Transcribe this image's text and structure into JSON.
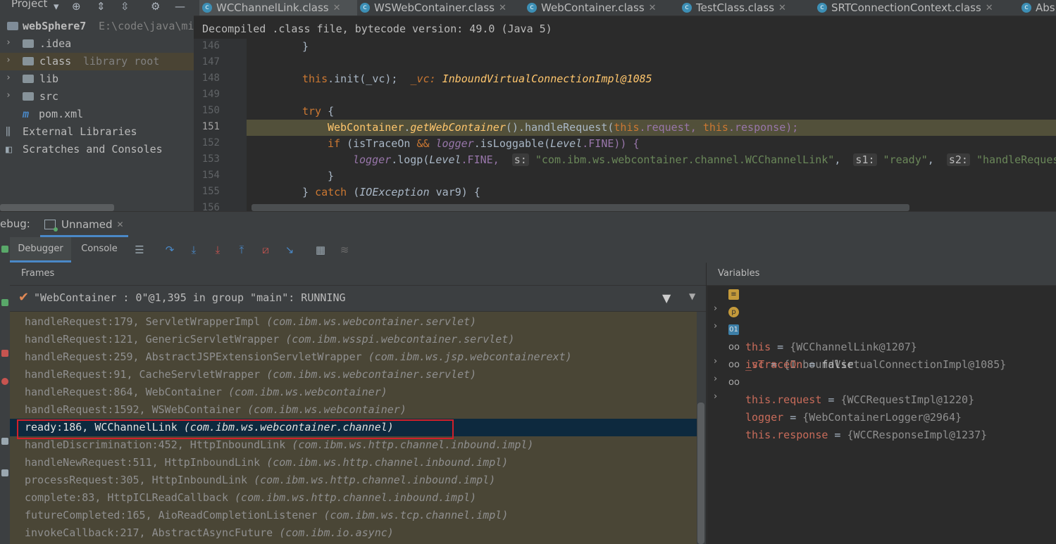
{
  "project_panel": {
    "title": "Project",
    "header_icons": [
      "dropdown-icon",
      "locate-icon",
      "expand-all-icon",
      "collapse-all-icon",
      "gear-icon",
      "hide-icon"
    ],
    "tree": [
      {
        "label": "webSphere7",
        "extra": "E:\\code\\java\\mi",
        "icon": "module-folder-icon",
        "bold": true
      },
      {
        "label": ".idea",
        "icon": "folder-icon"
      },
      {
        "label": "class",
        "extra": "library root",
        "icon": "folder-icon"
      },
      {
        "label": "lib",
        "icon": "folder-icon"
      },
      {
        "label": "src",
        "icon": "folder-icon"
      },
      {
        "label": "pom.xml",
        "icon": "maven-icon"
      },
      {
        "label": "External Libraries",
        "icon": "libraries-icon"
      },
      {
        "label": "Scratches and Consoles",
        "icon": "scratches-icon"
      }
    ]
  },
  "tabs": [
    {
      "label": "WCChannelLink.class",
      "active": true
    },
    {
      "label": "WSWebContainer.class"
    },
    {
      "label": "WebContainer.class"
    },
    {
      "label": "TestClass.class"
    },
    {
      "label": "SRTConnectionContext.class"
    },
    {
      "label": "Abs"
    }
  ],
  "editor": {
    "banner": "Decompiled .class file, bytecode version: 49.0 (Java 5)",
    "line_numbers": [
      "146",
      "147",
      "148",
      "149",
      "150",
      "151",
      "152",
      "153",
      "154",
      "155",
      "156"
    ],
    "current_line": "151",
    "code": {
      "l146": "}",
      "l148_a": "this",
      "l148_b": ".init(_vc);",
      "l148_hint_name": "_vc:",
      "l148_hint_val": "InboundVirtualConnectionImpl@1085",
      "l150_kw": "try",
      "l150_rest": " {",
      "l151_a": "WebContainer",
      "l151_b": ".",
      "l151_c": "getWebContainer",
      "l151_d": "().handleRequest(",
      "l151_e": "this",
      "l151_f": ".request, ",
      "l151_g": "this",
      "l151_h": ".response);",
      "l152_kw": "if",
      "l152_a": " (isTraceOn ",
      "l152_b": "&&",
      "l152_c": " ",
      "l152_d": "logger",
      "l152_e": ".isLoggable(",
      "l152_f": "Level",
      "l152_g": ".FINE)) {",
      "l153_a": "logger",
      "l153_b": ".logp(",
      "l153_c": "Level",
      "l153_d": ".FINE, ",
      "l153_s": "s:",
      "l153_sv": "\"com.ibm.ws.webcontainer.channel.WCChannelLink\"",
      "l153_comma1": ",",
      "l153_s1": "s1:",
      "l153_s1v": "\"ready\"",
      "l153_comma2": ",",
      "l153_s2": "s2:",
      "l153_s2v": "\"handleRequest co",
      "l154": "}",
      "l155_a": "} ",
      "l155_kw": "catch",
      "l155_b": " (",
      "l155_c": "IOException",
      "l155_d": " var9) {"
    }
  },
  "debug": {
    "label": "ebug:",
    "session": "Unnamed",
    "tabs": [
      "Debugger",
      "Console"
    ],
    "toolbar_icons": [
      "layout-icon",
      "step-over-icon",
      "step-into-icon",
      "force-step-into-icon",
      "step-out-icon",
      "drop-frame-icon",
      "run-to-cursor-icon",
      "evaluate-icon",
      "trace-icon"
    ],
    "frames_title": "Frames",
    "thread": "\"WebContainer : 0\"@1,395 in group \"main\": RUNNING",
    "frames": [
      {
        "method": "handleRequest:179, ServletWrapperImpl ",
        "pkg": "(com.ibm.ws.webcontainer.servlet)"
      },
      {
        "method": "handleRequest:121, GenericServletWrapper ",
        "pkg": "(com.ibm.wsspi.webcontainer.servlet)"
      },
      {
        "method": "handleRequest:259, AbstractJSPExtensionServletWrapper ",
        "pkg": "(com.ibm.ws.jsp.webcontainerext)"
      },
      {
        "method": "handleRequest:91, CacheServletWrapper ",
        "pkg": "(com.ibm.ws.webcontainer.servlet)"
      },
      {
        "method": "handleRequest:864, WebContainer ",
        "pkg": "(com.ibm.ws.webcontainer)"
      },
      {
        "method": "handleRequest:1592, WSWebContainer ",
        "pkg": "(com.ibm.ws.webcontainer)"
      },
      {
        "method": "ready:186, WCChannelLink ",
        "pkg": "(com.ibm.ws.webcontainer.channel)",
        "selected": true
      },
      {
        "method": "handleDiscrimination:452, HttpInboundLink ",
        "pkg": "(com.ibm.ws.http.channel.inbound.impl)"
      },
      {
        "method": "handleNewRequest:511, HttpInboundLink ",
        "pkg": "(com.ibm.ws.http.channel.inbound.impl)"
      },
      {
        "method": "processRequest:305, HttpInboundLink ",
        "pkg": "(com.ibm.ws.http.channel.inbound.impl)"
      },
      {
        "method": "complete:83, HttpICLReadCallback ",
        "pkg": "(com.ibm.ws.http.channel.inbound.impl)"
      },
      {
        "method": "futureCompleted:165, AioReadCompletionListener ",
        "pkg": "(com.ibm.ws.tcp.channel.impl)"
      },
      {
        "method": "invokeCallback:217, AbstractAsyncFuture ",
        "pkg": "(com.ibm.io.async)"
      }
    ],
    "variables_title": "Variables",
    "variables": [
      {
        "name": "this",
        "eq": " = ",
        "value": "{WCChannelLink@1207}",
        "icon": "field-icon",
        "expandable": true
      },
      {
        "name": "_vc",
        "eq": " = ",
        "value": "{InboundVirtualConnectionImpl@1085}",
        "icon": "parameter-icon",
        "expandable": true
      },
      {
        "name": "isTraceOn",
        "eq": " = ",
        "value": "false",
        "icon": "primitive-icon",
        "expandable": false
      },
      {
        "name": "this.request",
        "eq": " = ",
        "value": "{WCCRequestImpl@1220}",
        "icon": "watch-icon",
        "expandable": true
      },
      {
        "name": "logger",
        "eq": " = ",
        "value": "{WebContainerLogger@2964}",
        "icon": "watch-icon",
        "expandable": true
      },
      {
        "name": "this.response",
        "eq": " = ",
        "value": "{WCCResponseImpl@1237}",
        "icon": "watch-icon",
        "expandable": true
      }
    ]
  }
}
